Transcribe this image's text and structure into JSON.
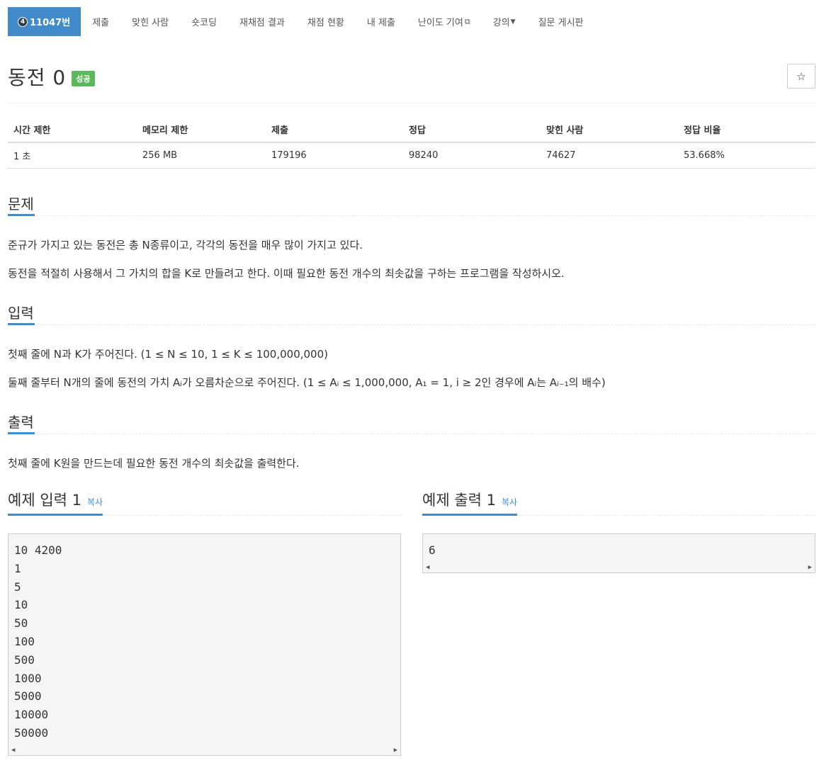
{
  "nav": {
    "problem_number": "11047번",
    "tier_icon": "4",
    "items": [
      {
        "label": "제출"
      },
      {
        "label": "맞힌 사람"
      },
      {
        "label": "숏코딩"
      },
      {
        "label": "재채점 결과"
      },
      {
        "label": "채점 현황"
      },
      {
        "label": "내 제출"
      },
      {
        "label": "난이도 기여"
      },
      {
        "label": "강의"
      },
      {
        "label": "질문 게시판"
      }
    ]
  },
  "problem": {
    "title": "동전 0",
    "status_badge": "성공",
    "star": "☆"
  },
  "info_table": {
    "headers": [
      "시간 제한",
      "메모리 제한",
      "제출",
      "정답",
      "맞힌 사람",
      "정답 비율"
    ],
    "values": [
      "1 초",
      "256 MB",
      "179196",
      "98240",
      "74627",
      "53.668%"
    ]
  },
  "description": {
    "heading": "문제",
    "p1": "준규가 가지고 있는 동전은 총 N종류이고, 각각의 동전을 매우 많이 가지고 있다.",
    "p2": "동전을 적절히 사용해서 그 가치의 합을 K로 만들려고 한다. 이때 필요한 동전 개수의 최솟값을 구하는 프로그램을 작성하시오."
  },
  "input": {
    "heading": "입력",
    "p1": "첫째 줄에 N과 K가 주어진다. (1 ≤ N ≤ 10, 1 ≤ K ≤ 100,000,000)",
    "p2": "둘째 줄부터 N개의 줄에 동전의 가치 Aᵢ가 오름차순으로 주어진다. (1 ≤ Aᵢ ≤ 1,000,000, A₁ = 1, i ≥ 2인 경우에 Aᵢ는 Aᵢ₋₁의 배수)"
  },
  "output": {
    "heading": "출력",
    "p1": "첫째 줄에 K원을 만드는데 필요한 동전 개수의 최솟값을 출력한다."
  },
  "sample_input": {
    "heading": "예제 입력 1",
    "copy": "복사",
    "lines": [
      "10 4200",
      "1",
      "5",
      "10",
      "50",
      "100",
      "500",
      "1000",
      "5000",
      "10000",
      "50000"
    ]
  },
  "sample_output": {
    "heading": "예제 출력 1",
    "copy": "복사",
    "lines": [
      "6"
    ]
  }
}
